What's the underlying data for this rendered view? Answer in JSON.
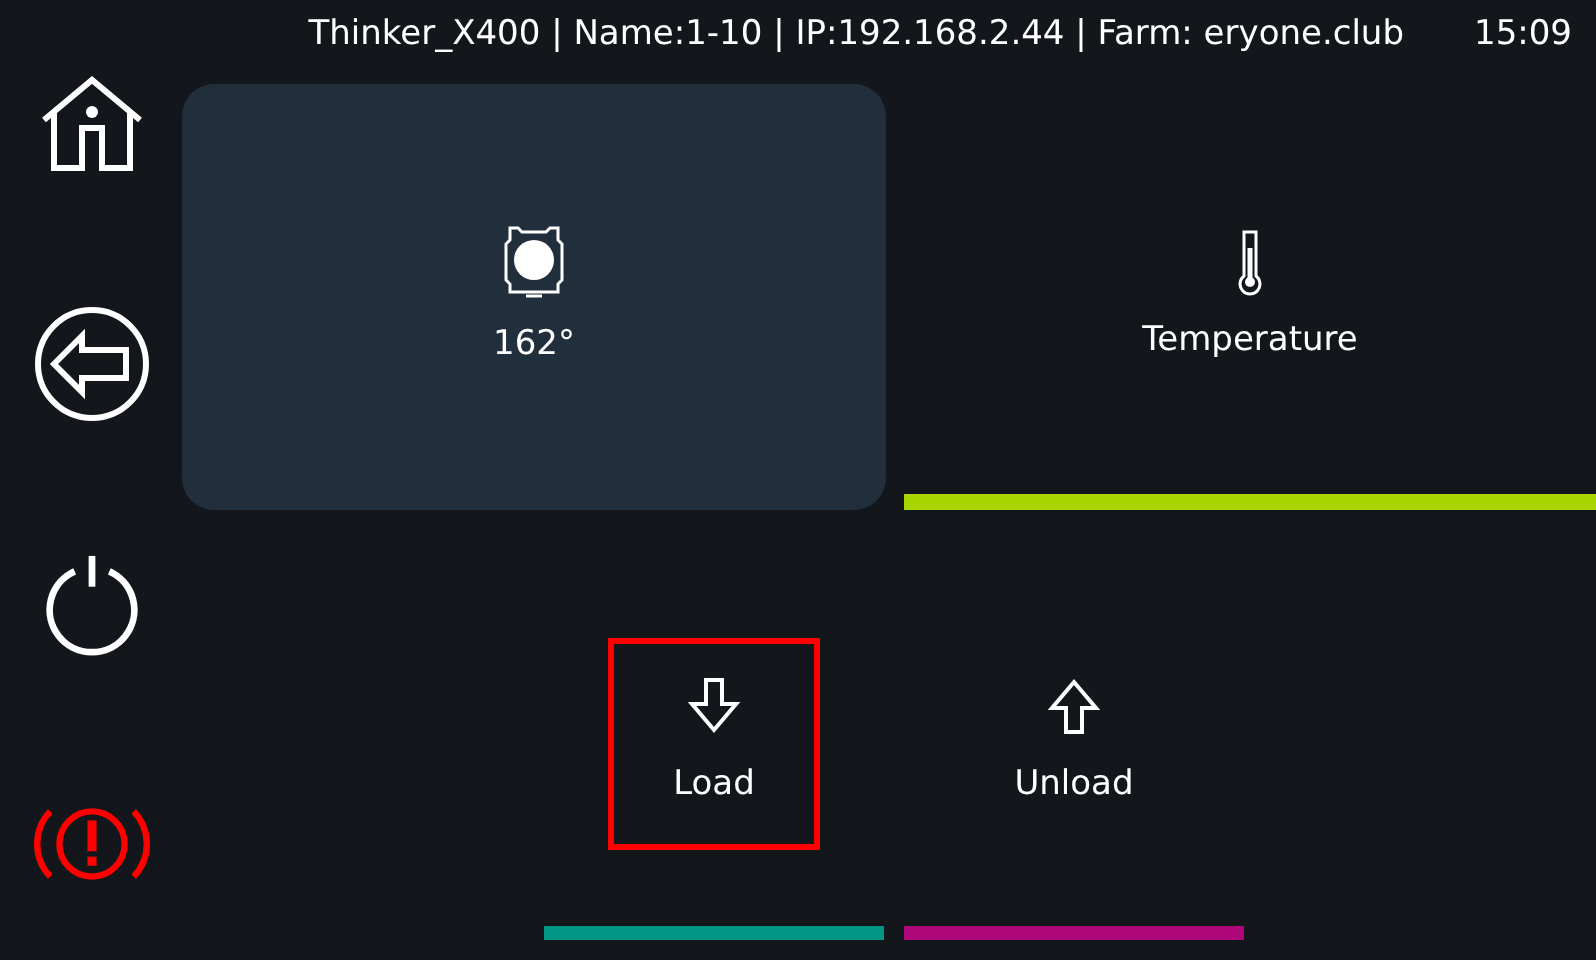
{
  "status_bar": {
    "info": "Thinker_X400 | Name:1-10 | IP:192.168.2.44 | Farm: eryone.club",
    "time": "15:09"
  },
  "sidebar": {
    "items": [
      {
        "kind": "home"
      },
      {
        "kind": "back"
      },
      {
        "kind": "power"
      },
      {
        "kind": "alert"
      }
    ]
  },
  "tiles": [
    {
      "kind": "nozzle",
      "label": "162°",
      "selected": true
    },
    {
      "kind": "thermometer",
      "label": "Temperature",
      "selected": false,
      "color": "#a8d400"
    }
  ],
  "actions": [
    {
      "kind": "load",
      "label": "Load",
      "selected": true,
      "color": "#009683"
    },
    {
      "kind": "unload",
      "label": "Unload",
      "selected": false,
      "color": "#b0087a"
    }
  ]
}
